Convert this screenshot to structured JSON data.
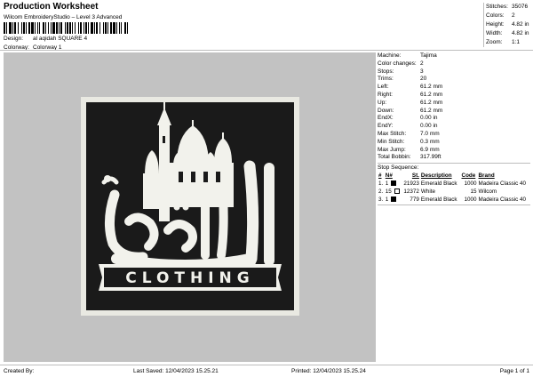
{
  "header": {
    "title": "Production Worksheet",
    "subtitle": "Wilcom EmbroideryStudio – Level 3 Advanced",
    "design_label": "Design:",
    "design_value": "al aqidah SQUARE 4",
    "colorway_label": "Colorway:",
    "colorway_value": "Colorway 1"
  },
  "stats": [
    {
      "label": "Stitches:",
      "value": "35076"
    },
    {
      "label": "Colors:",
      "value": "2"
    },
    {
      "label": "Height:",
      "value": "4.82 in"
    },
    {
      "label": "Width:",
      "value": "4.82 in"
    },
    {
      "label": "Zoom:",
      "value": "1:1"
    }
  ],
  "info": [
    {
      "label": "Machine:",
      "value": "Tajima"
    },
    {
      "label": "Color changes:",
      "value": "2"
    },
    {
      "label": "Stops:",
      "value": "3"
    },
    {
      "label": "Trims:",
      "value": "20"
    },
    {
      "label": "Left:",
      "value": "61.2 mm"
    },
    {
      "label": "Right:",
      "value": "61.2 mm"
    },
    {
      "label": "Up:",
      "value": "61.2 mm"
    },
    {
      "label": "Down:",
      "value": "61.2 mm"
    },
    {
      "label": "EndX:",
      "value": "0.00 in"
    },
    {
      "label": "EndY:",
      "value": "0.00 in"
    },
    {
      "label": "Max Stitch:",
      "value": "7.0 mm"
    },
    {
      "label": "Min Stitch:",
      "value": "0.3 mm"
    },
    {
      "label": "Max Jump:",
      "value": "6.9 mm"
    },
    {
      "label": "Total Bobbin:",
      "value": "317.99ft"
    }
  ],
  "stop_sequence": {
    "title": "Stop Sequence:",
    "columns": [
      "#",
      "N#",
      "St.",
      "Description",
      "Code",
      "Brand"
    ],
    "rows": [
      {
        "num": "1.",
        "n": "1",
        "color": "#000000",
        "stitches": "21923",
        "description": "Emerald Black",
        "code": "1000",
        "brand": "Madeira Classic 40"
      },
      {
        "num": "2.",
        "n": "15",
        "color": "#ffffff",
        "stitches": "12372",
        "description": "White",
        "code": "15",
        "brand": "Wilcom"
      },
      {
        "num": "3.",
        "n": "1",
        "color": "#000000",
        "stitches": "779",
        "description": "Emerald Black",
        "code": "1000",
        "brand": "Madeira Classic 40"
      }
    ]
  },
  "design": {
    "clothing_text": "CLOTHING",
    "patch_color": "#1a1a1a",
    "thread_color": "#f2f2ec"
  },
  "footer": {
    "created_by": "Created By:",
    "last_saved": "Last Saved: 12/04/2023 15.25.21",
    "printed": "Printed: 12/04/2023 15.25.24",
    "page": "Page 1 of 1"
  }
}
